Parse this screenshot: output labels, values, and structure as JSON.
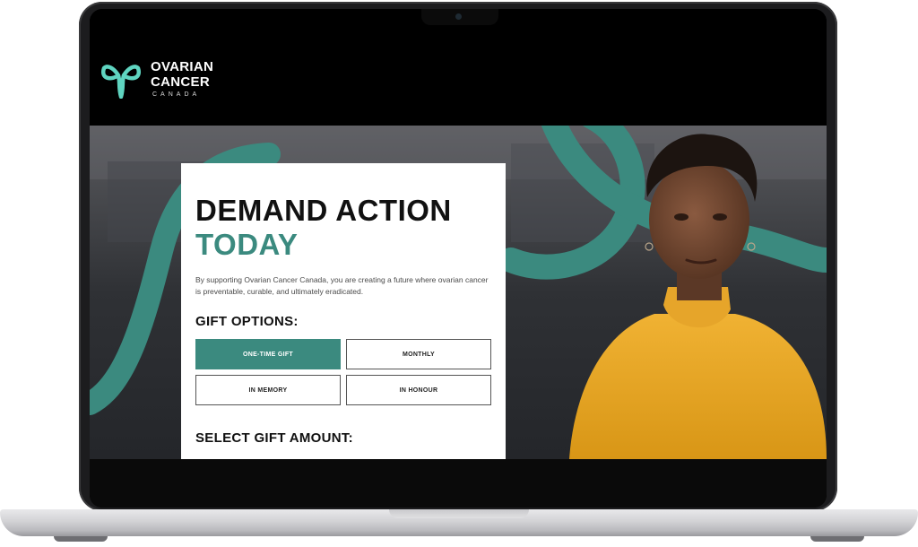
{
  "brand": {
    "line1": "OVARIAN",
    "line2": "CANCER",
    "sub": "CANADA",
    "accent_color": "#3b8a7f"
  },
  "hero": {
    "title_line1": "DEMAND ACTION",
    "title_line2": "TODAY",
    "description": "By supporting Ovarian Cancer Canada, you are creating a future where ovarian cancer is preventable, curable, and ultimately eradicated.",
    "gift_options_label": "GIFT OPTIONS:",
    "gift_options": [
      {
        "label": "ONE-TIME GIFT",
        "selected": true
      },
      {
        "label": "MONTHLY",
        "selected": false
      },
      {
        "label": "IN MEMORY",
        "selected": false
      },
      {
        "label": "IN HONOUR",
        "selected": false
      }
    ],
    "select_amount_label": "SELECT GIFT AMOUNT:"
  },
  "icons": [
    "ovarian-ribbon-logo-icon"
  ]
}
